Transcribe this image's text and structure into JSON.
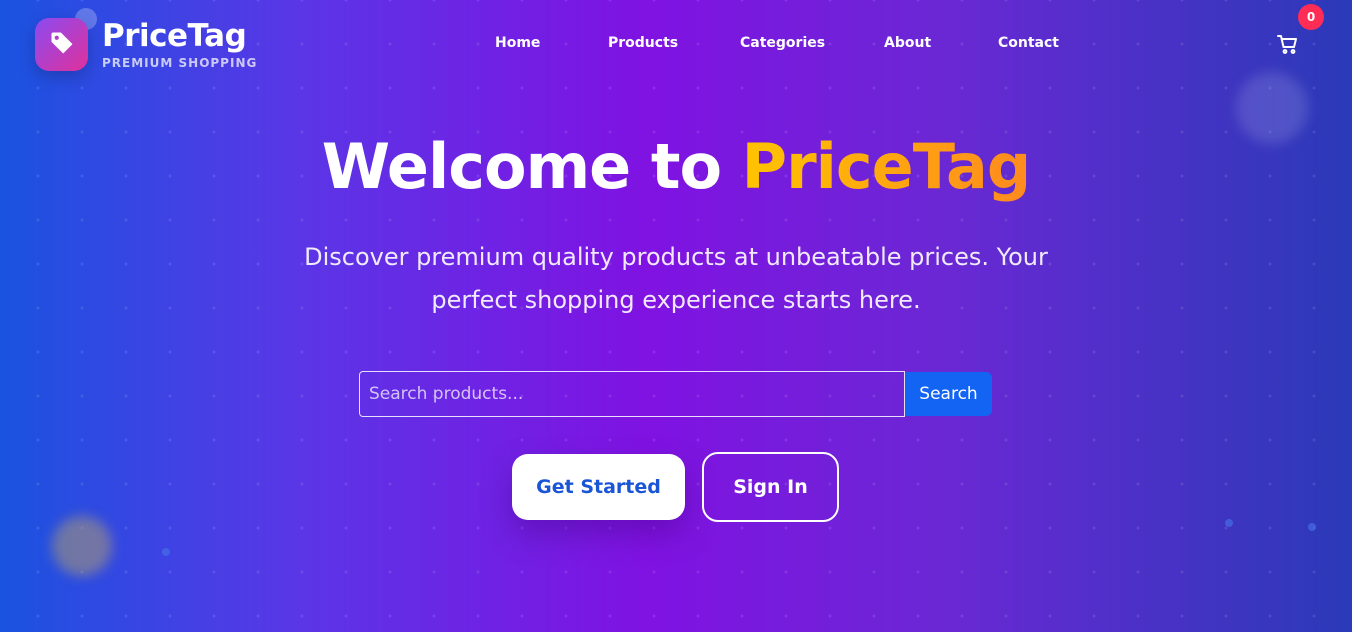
{
  "brand": {
    "name": "PriceTag",
    "tagline": "PREMIUM SHOPPING",
    "icon": "tag-icon",
    "gradient": [
      "#8b4bf2",
      "#e0319a"
    ]
  },
  "nav": {
    "items": [
      {
        "label": "Home"
      },
      {
        "label": "Products"
      },
      {
        "label": "Categories"
      },
      {
        "label": "About"
      },
      {
        "label": "Contact"
      }
    ]
  },
  "cart": {
    "icon": "shopping-cart-icon",
    "count": "0",
    "badge_color": "#ff2d55"
  },
  "hero": {
    "title_prefix": "Welcome to",
    "title_accent": "PriceTag",
    "subtitle": "Discover premium quality products at unbeatable prices. Your perfect shopping experience starts here.",
    "accent_colors": [
      "#ffc400",
      "#ff8a1f"
    ]
  },
  "search": {
    "placeholder": "Search products...",
    "value": "",
    "button_label": "Search",
    "button_color": "#1464f4"
  },
  "cta": {
    "primary_label": "Get Started",
    "secondary_label": "Sign In"
  }
}
